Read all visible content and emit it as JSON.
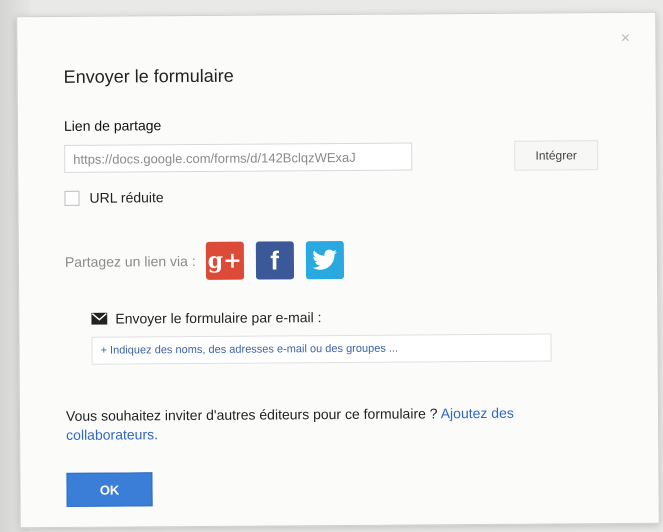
{
  "dialog": {
    "title": "Envoyer le formulaire",
    "close_icon": "×"
  },
  "share_link": {
    "label": "Lien de partage",
    "url_value": "https://docs.google.com/forms/d/142BclqzWExaJ",
    "embed_label": "Intégrer",
    "short_url_label": "URL réduite",
    "short_url_checked": false
  },
  "share_via": {
    "label": "Partagez un lien via :",
    "networks": [
      {
        "name": "google-plus",
        "glyph": "g+",
        "color": "#dc4a38"
      },
      {
        "name": "facebook",
        "glyph": "f",
        "color": "#3b5998"
      },
      {
        "name": "twitter",
        "glyph": "twitter-bird",
        "color": "#2aa9e0"
      }
    ]
  },
  "email": {
    "heading": "Envoyer le formulaire par e-mail :",
    "placeholder": "+ Indiquez des noms, des adresses e-mail ou des groupes ..."
  },
  "invite": {
    "text": "Vous souhaitez inviter d'autres éditeurs pour ce formulaire ?",
    "link": "Ajoutez des collaborateurs."
  },
  "ok_label": "OK"
}
